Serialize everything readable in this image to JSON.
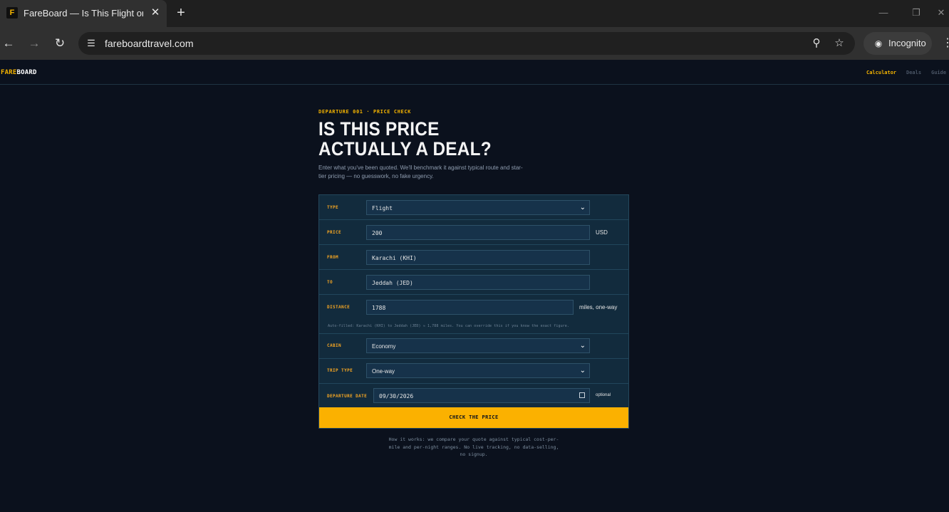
{
  "browser": {
    "tab_favicon": "F",
    "tab_title": "FareBoard — Is This Flight or Ho",
    "tab_close": "✕",
    "new_tab": "+",
    "url": "fareboardtravel.com",
    "incognito_label": "Incognito",
    "icons": [
      "back-icon",
      "forward-icon",
      "reload-icon",
      "site-info-icon",
      "zoom-icon",
      "star-icon",
      "incognito-icon",
      "menu-icon"
    ]
  },
  "site": {
    "logo_accent": "FARE",
    "logo_rest": "BOARD",
    "nav": [
      "Calculator",
      "Deals",
      "Guide"
    ],
    "kicker": "DEPARTURE 001 · PRICE CHECK",
    "heading_line1": "IS THIS PRICE",
    "heading_line2": "ACTUALLY A DEAL?",
    "lead": "Enter what you've been quoted. We'll benchmark it against typical route and star-tier pricing — no guesswork, no fake urgency.",
    "colors": {
      "accent": "#f5b400",
      "background": "#0b111d",
      "card": "#122b3d"
    }
  },
  "form": {
    "type_label": "TYPE",
    "type_value": "Flight",
    "price_label": "PRICE",
    "price_value": "200",
    "price_currency": "USD",
    "from_label": "FROM",
    "from_value": "Karachi (KHI)",
    "to_label": "TO",
    "to_value": "Jeddah (JED)",
    "distance_label": "DISTANCE",
    "distance_value": "1788",
    "distance_unit": "miles, one-way",
    "distance_note": "Auto-filled: Karachi (KHI) to Jeddah (JED) ≈ 1,788 miles. You can override this if you know the exact figure.",
    "cabin_label": "CABIN",
    "cabin_value": "Economy",
    "trip_label": "TRIP TYPE",
    "trip_value": "One-way",
    "date_label": "DEPARTURE DATE",
    "date_value": "09/30/2026",
    "date_optional": "optional",
    "cta": "CHECK THE PRICE"
  },
  "footnote": "How it works: we compare your quote against typical cost-per-mile and per-night ranges. No live tracking, no data-selling, no signup."
}
